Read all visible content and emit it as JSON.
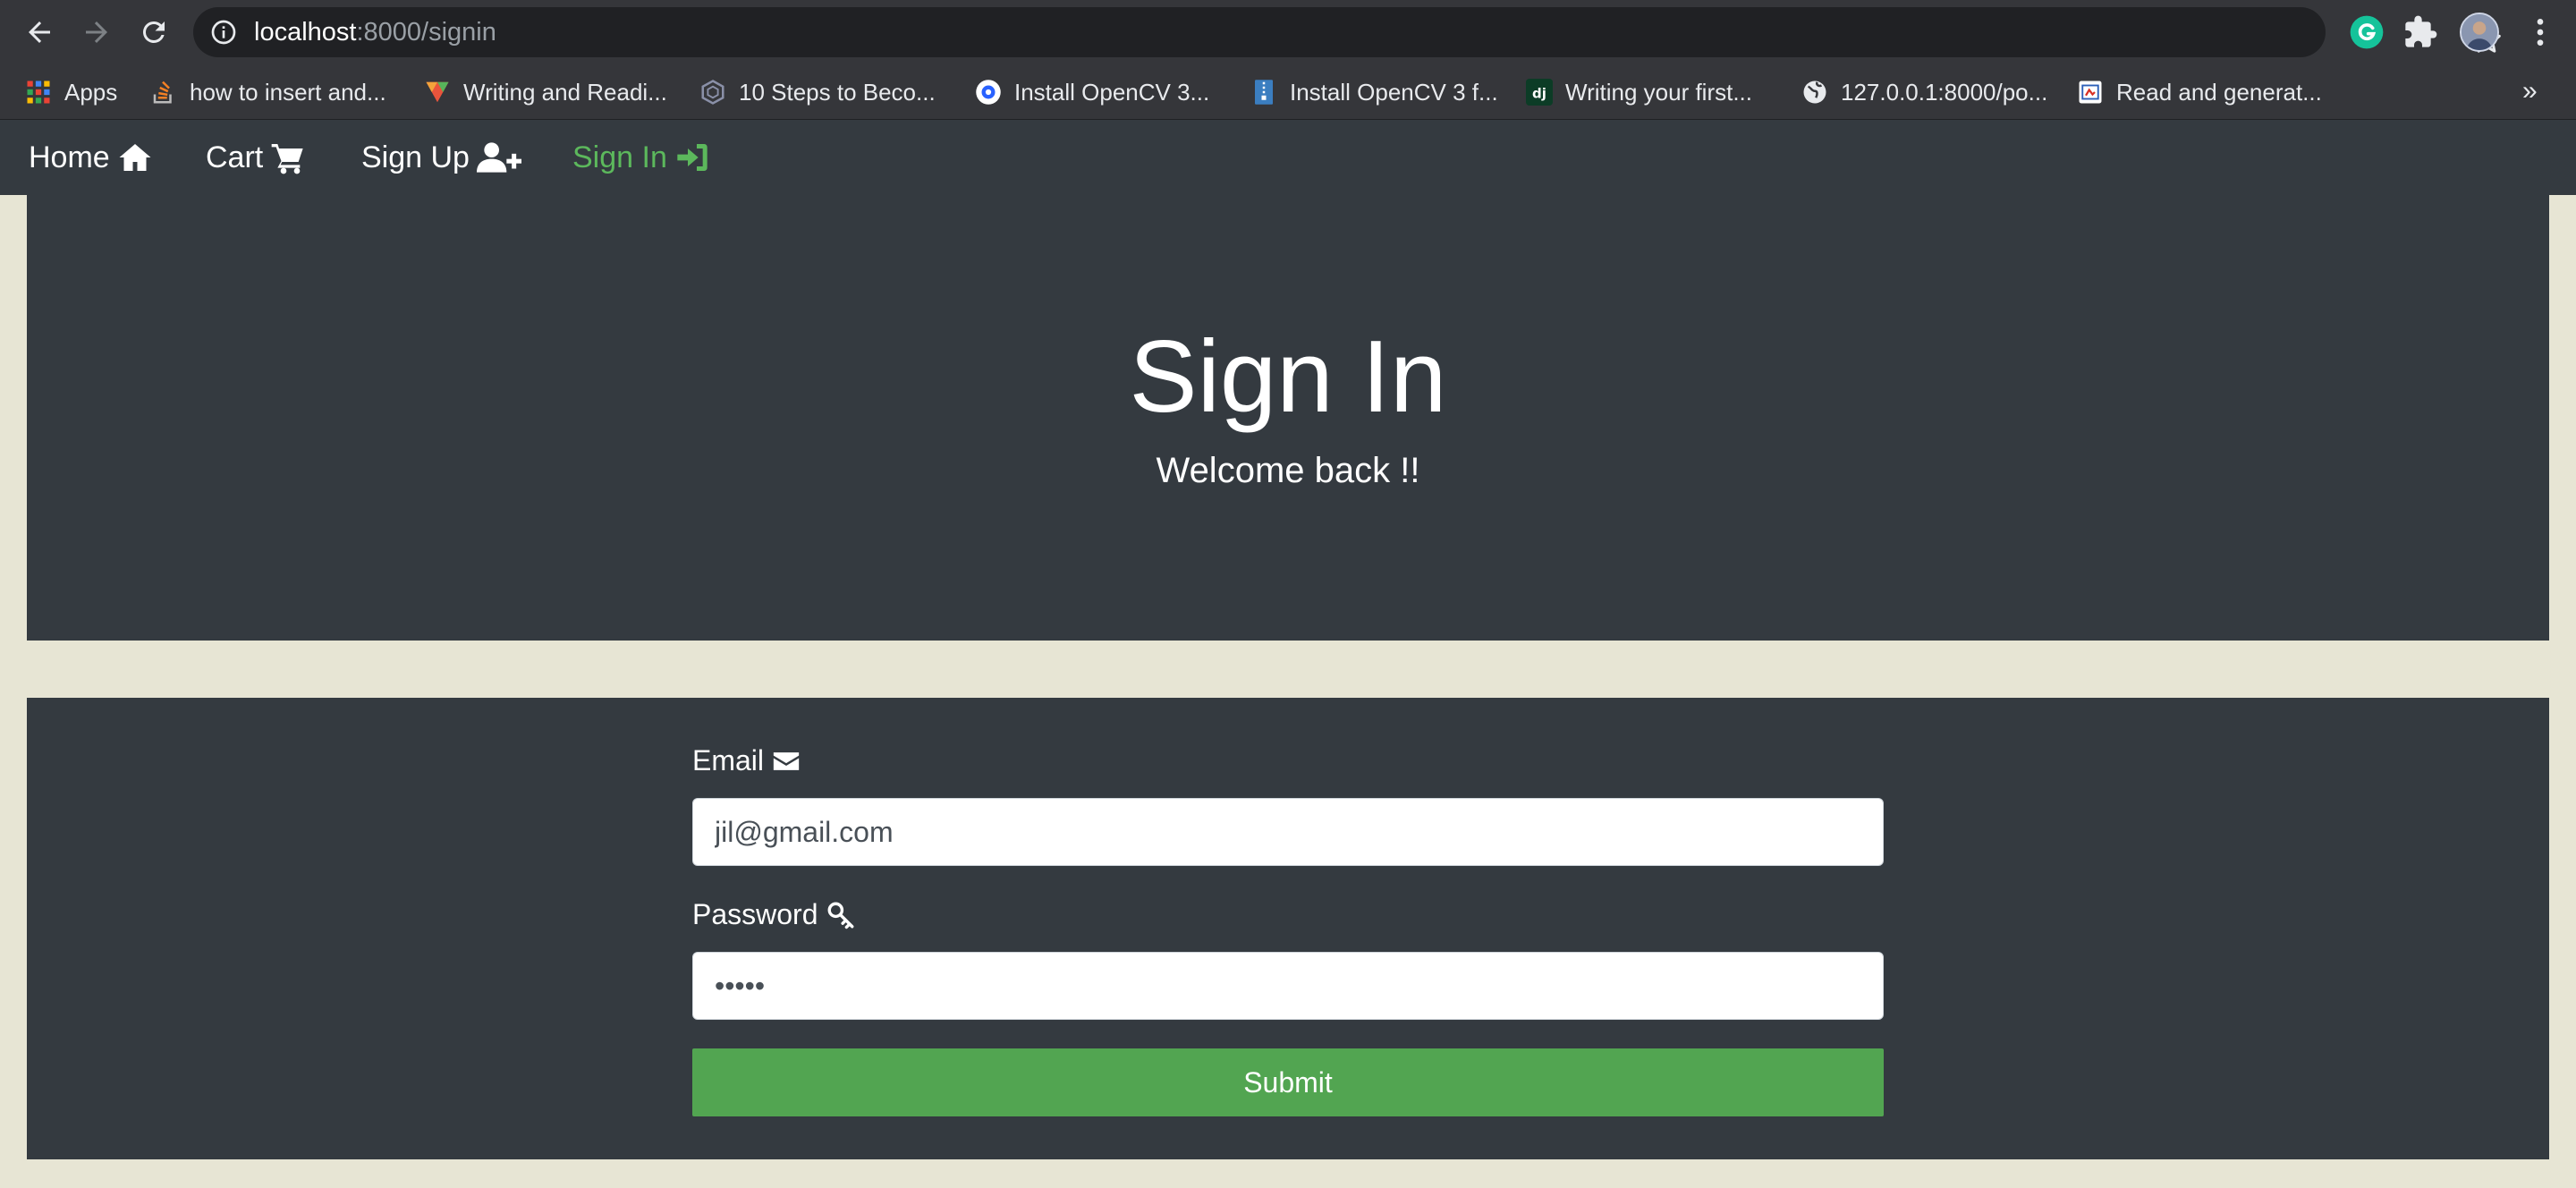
{
  "browser": {
    "url_host": "localhost",
    "url_path": ":8000/signin",
    "bookmarks": [
      {
        "label": "Apps",
        "icon": "apps-grid-icon"
      },
      {
        "label": "how to insert and...",
        "icon": "stackoverflow-icon"
      },
      {
        "label": "Writing and Readi...",
        "icon": "medium-m-icon"
      },
      {
        "label": "10 Steps to Beco...",
        "icon": "hexagon-icon"
      },
      {
        "label": "Install OpenCV 3...",
        "icon": "opencv-icon"
      },
      {
        "label": "Install OpenCV 3 f...",
        "icon": "zip-icon"
      },
      {
        "label": "Writing your first...",
        "icon": "django-icon"
      },
      {
        "label": "127.0.0.1:8000/po...",
        "icon": "globe-icon"
      },
      {
        "label": "Read and generat...",
        "icon": "page-icon"
      }
    ],
    "more": "»"
  },
  "nav": {
    "home": "Home",
    "cart": "Cart",
    "signup": "Sign Up",
    "signin": "Sign In"
  },
  "hero": {
    "title": "Sign In",
    "subtitle": "Welcome back !!"
  },
  "form": {
    "email_label": "Email",
    "email_value": "jil@gmail.com",
    "password_label": "Password",
    "password_value": "•••••",
    "submit_label": "Submit"
  },
  "colors": {
    "page_bg": "#e7e5d4",
    "panel_bg": "#343a40",
    "active_nav": "#5cb85c",
    "submit_bg": "#52a551"
  }
}
